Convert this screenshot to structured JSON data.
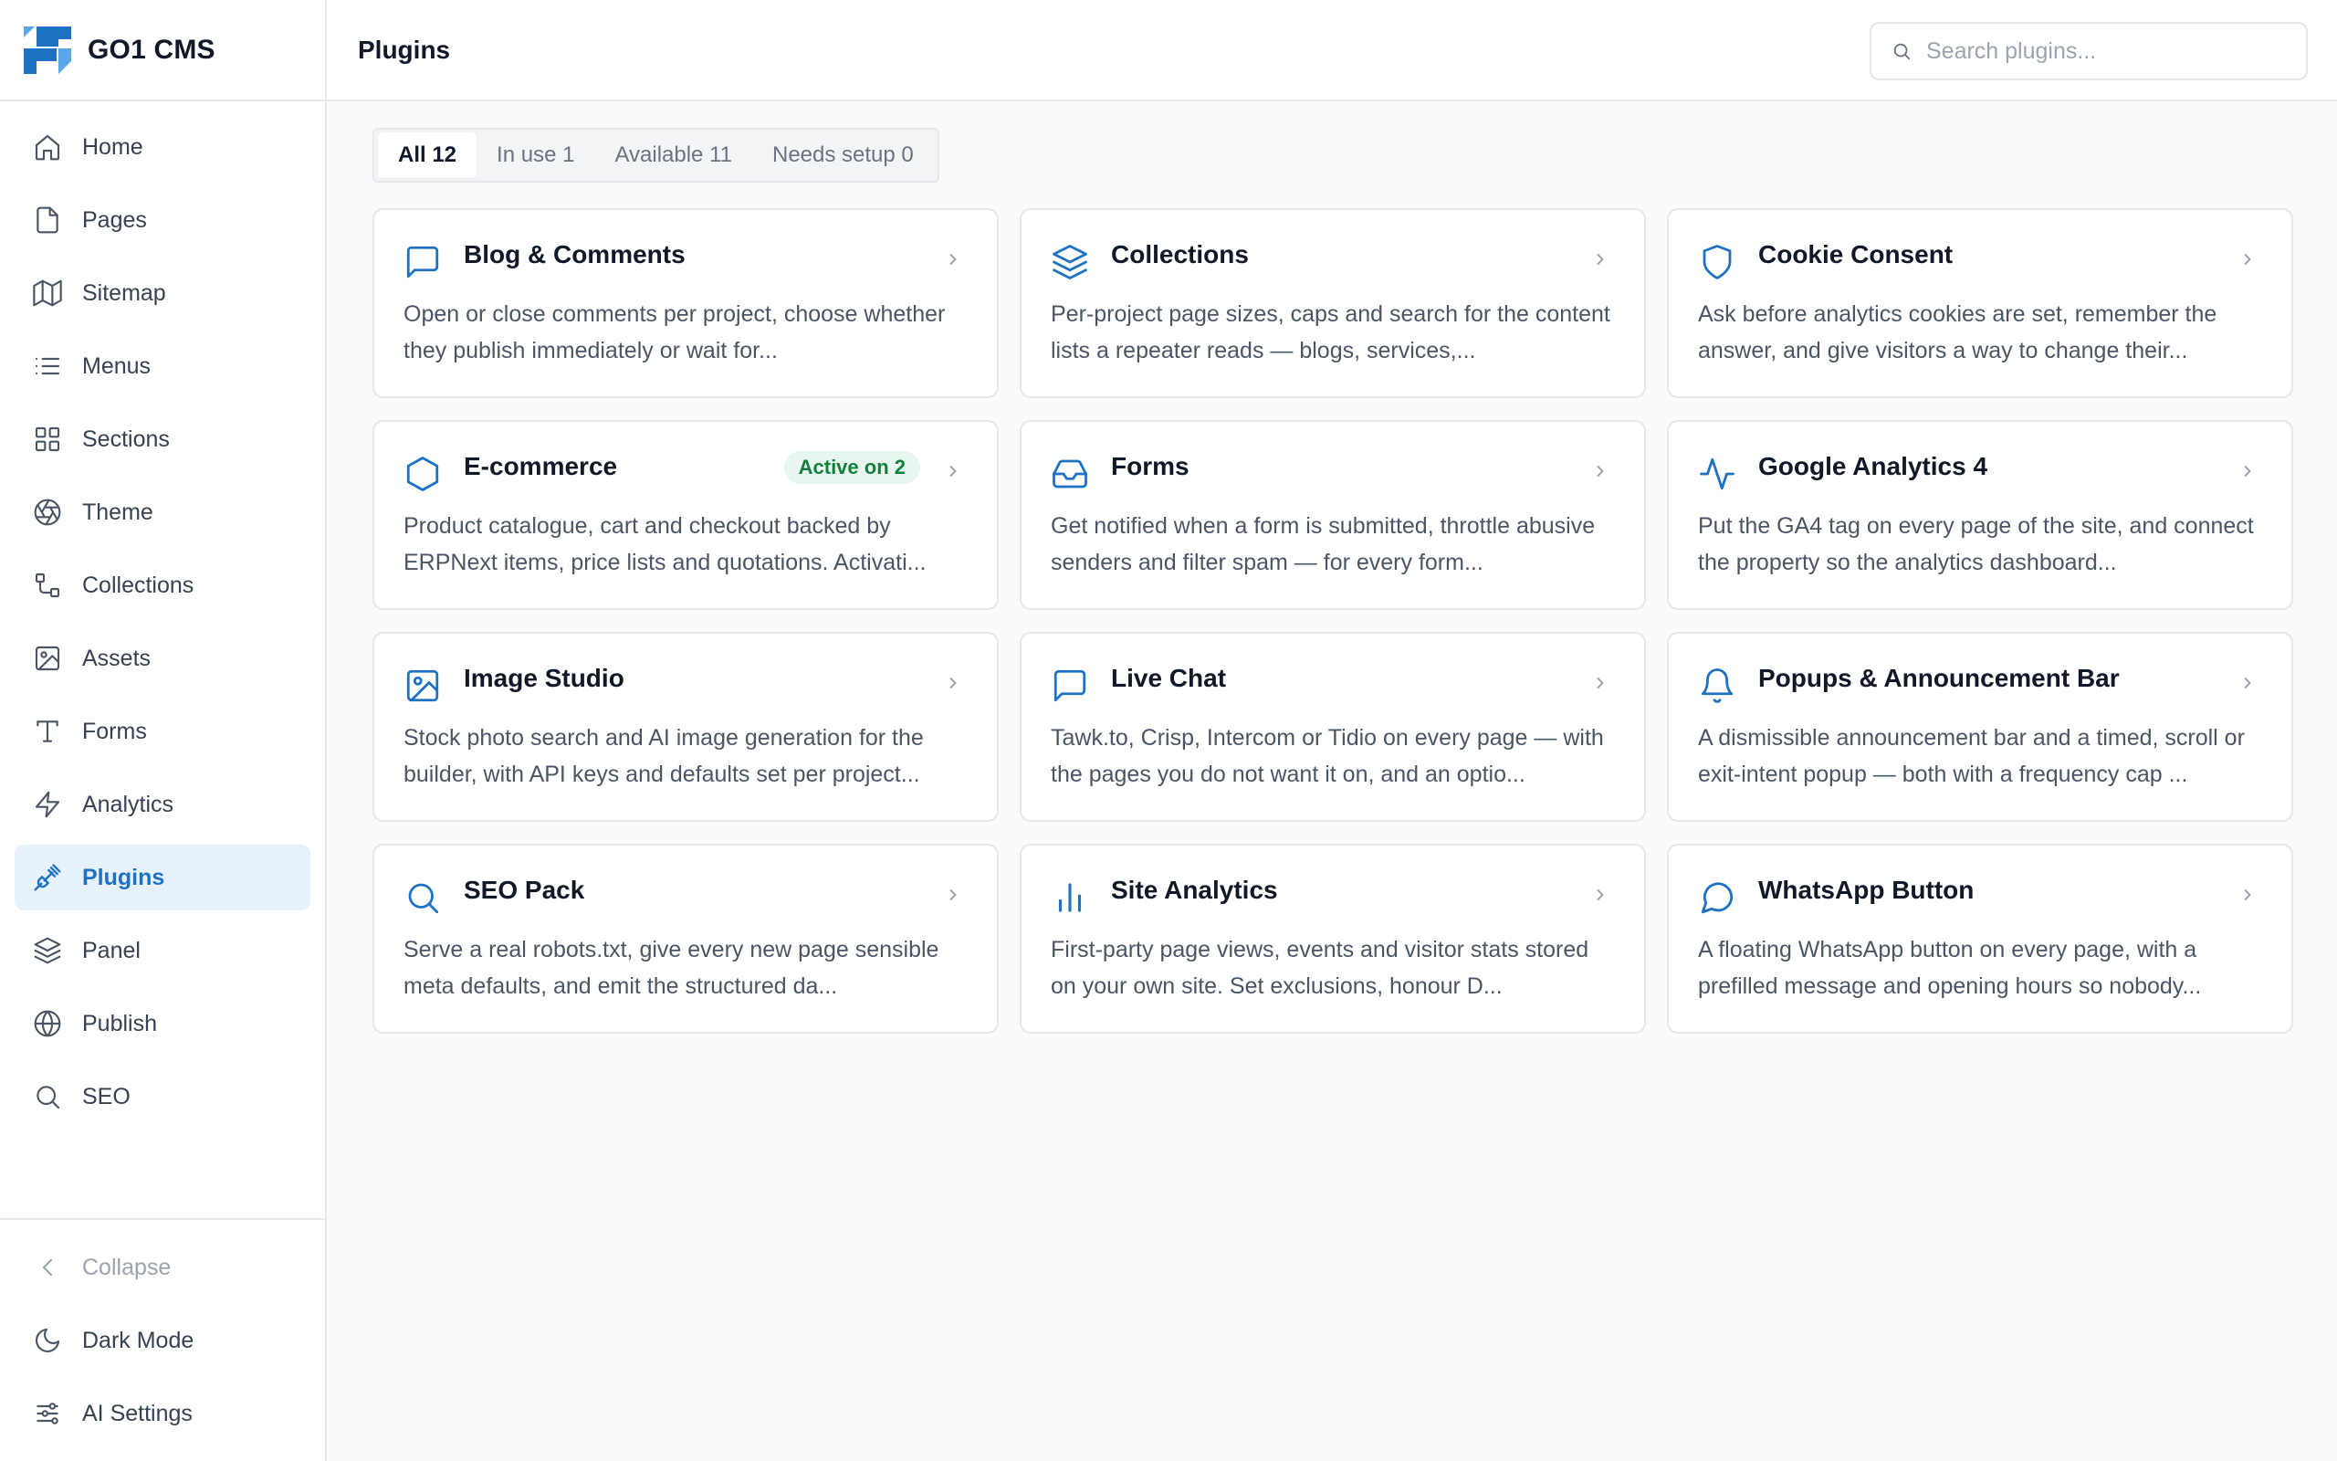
{
  "app": {
    "name": "GO1 CMS"
  },
  "sidebar": {
    "items": [
      {
        "label": "Home",
        "icon": "home-icon"
      },
      {
        "label": "Pages",
        "icon": "file-icon"
      },
      {
        "label": "Sitemap",
        "icon": "map-icon"
      },
      {
        "label": "Menus",
        "icon": "list-icon"
      },
      {
        "label": "Sections",
        "icon": "grid-icon"
      },
      {
        "label": "Theme",
        "icon": "aperture-icon"
      },
      {
        "label": "Collections",
        "icon": "collections-icon"
      },
      {
        "label": "Assets",
        "icon": "image-icon"
      },
      {
        "label": "Forms",
        "icon": "type-icon"
      },
      {
        "label": "Analytics",
        "icon": "lightning-icon"
      },
      {
        "label": "Plugins",
        "icon": "plug-icon",
        "active": true
      },
      {
        "label": "Panel",
        "icon": "layers-icon"
      },
      {
        "label": "Publish",
        "icon": "globe-icon"
      },
      {
        "label": "SEO",
        "icon": "search-icon"
      }
    ],
    "footer": {
      "collapse": "Collapse",
      "dark_mode": "Dark Mode",
      "ai_settings": "AI Settings"
    }
  },
  "header": {
    "title": "Plugins",
    "search_placeholder": "Search plugins..."
  },
  "tabs": [
    {
      "label": "All 12",
      "active": true
    },
    {
      "label": "In use 1"
    },
    {
      "label": "Available 11"
    },
    {
      "label": "Needs setup 0"
    }
  ],
  "plugins": [
    {
      "title": "Blog & Comments",
      "icon": "message-square-icon",
      "description": "Open or close comments per project, choose whether they publish immediately or wait for..."
    },
    {
      "title": "Collections",
      "icon": "layers-icon",
      "description": "Per-project page sizes, caps and search for the content lists a repeater reads — blogs, services,..."
    },
    {
      "title": "Cookie Consent",
      "icon": "shield-icon",
      "description": "Ask before analytics cookies are set, remember the answer, and give visitors a way to change their..."
    },
    {
      "title": "E-commerce",
      "icon": "hexagon-icon",
      "badge": "Active on 2",
      "description": "Product catalogue, cart and checkout backed by ERPNext items, price lists and quotations. Activati..."
    },
    {
      "title": "Forms",
      "icon": "inbox-icon",
      "description": "Get notified when a form is submitted, throttle abusive senders and filter spam — for every form..."
    },
    {
      "title": "Google Analytics 4",
      "icon": "activity-icon",
      "description": "Put the GA4 tag on every page of the site, and connect the property so the analytics dashboard..."
    },
    {
      "title": "Image Studio",
      "icon": "image-icon",
      "description": "Stock photo search and AI image generation for the builder, with API keys and defaults set per project..."
    },
    {
      "title": "Live Chat",
      "icon": "message-square-icon",
      "description": "Tawk.to, Crisp, Intercom or Tidio on every page — with the pages you do not want it on, and an optio..."
    },
    {
      "title": "Popups & Announcement Bar",
      "icon": "bell-icon",
      "description": "A dismissible announcement bar and a timed, scroll or exit-intent popup — both with a frequency cap ..."
    },
    {
      "title": "SEO Pack",
      "icon": "search-icon",
      "description": "Serve a real robots.txt, give every new page sensible meta defaults, and emit the structured da..."
    },
    {
      "title": "Site Analytics",
      "icon": "bar-chart-icon",
      "description": "First-party page views, events and visitor stats stored on your own site. Set exclusions, honour D..."
    },
    {
      "title": "WhatsApp Button",
      "icon": "message-circle-icon",
      "description": "A floating WhatsApp button on every page, with a prefilled message and opening hours so nobody..."
    }
  ],
  "colors": {
    "accent": "#1d72c4",
    "active_bg": "#e6f1fb",
    "badge_bg": "#e7f6ee",
    "badge_text": "#15803d"
  }
}
